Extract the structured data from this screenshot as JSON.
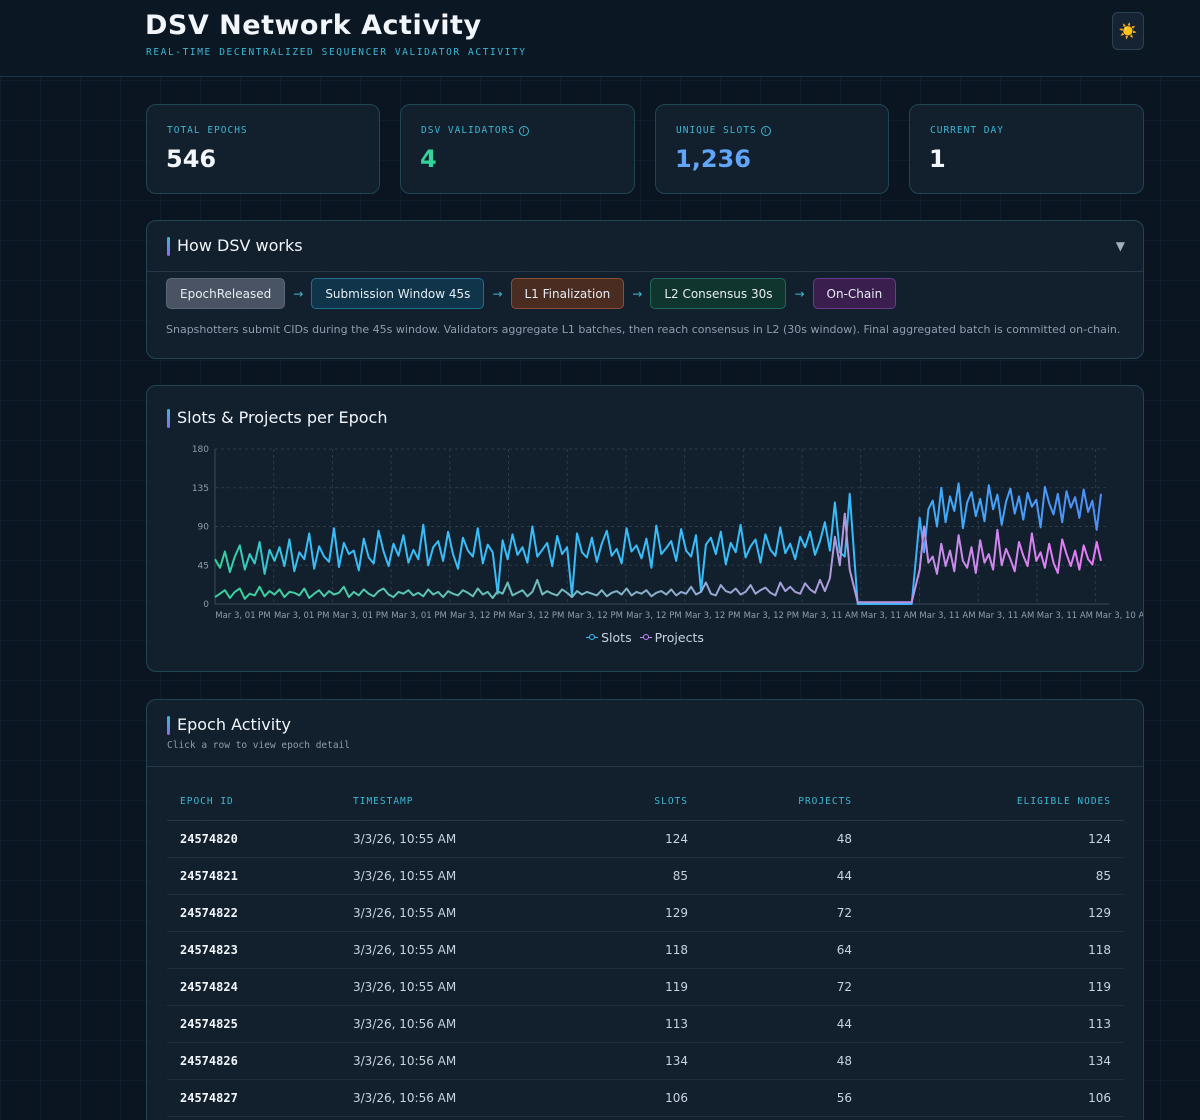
{
  "header": {
    "title": "DSV Network Activity",
    "subtitle": "REAL-TIME DECENTRALIZED SEQUENCER VALIDATOR ACTIVITY",
    "theme_icon": "sun-icon",
    "theme_glyph": "☀️"
  },
  "stats": [
    {
      "label": "TOTAL EPOCHS",
      "value": "546",
      "color": "#f2f6fa",
      "info": false
    },
    {
      "label": "DSV VALIDATORS",
      "value": "4",
      "color": "#34d399",
      "info": true
    },
    {
      "label": "UNIQUE SLOTS",
      "value": "1,236",
      "color": "#60a5fa",
      "info": true
    },
    {
      "label": "CURRENT DAY",
      "value": "1",
      "color": "#f2f6fa",
      "info": false
    }
  ],
  "how": {
    "title": "How DSV works",
    "chevron": "▼",
    "steps": [
      {
        "label": "EpochReleased",
        "bg": "#4a5363",
        "border": "#5c6676"
      },
      {
        "label": "Submission Window 45s",
        "bg": "#10344a",
        "border": "#1f6f93"
      },
      {
        "label": "L1 Finalization",
        "bg": "#4a2c20",
        "border": "#8a4f35"
      },
      {
        "label": "L2 Consensus 30s",
        "bg": "#10352f",
        "border": "#1f6a5a"
      },
      {
        "label": "On-Chain",
        "bg": "#3a1f4e",
        "border": "#6a3a8e"
      }
    ],
    "arrow": "→",
    "description": "Snapshotters submit CIDs during the 45s window. Validators aggregate L1 batches, then reach consensus in L2 (30s window). Final aggregated batch is committed on-chain."
  },
  "chart": {
    "title": "Slots & Projects per Epoch"
  },
  "chart_data": {
    "type": "line",
    "ylim": [
      0,
      180
    ],
    "yticks": [
      0,
      45,
      90,
      135,
      180
    ],
    "x_tick_labels": [
      "Mar 3, 01 PM",
      "Mar 3, 01 PM",
      "Mar 3, 01 PM",
      "Mar 3, 01 PM",
      "Mar 3, 12 PM",
      "Mar 3, 12 PM",
      "Mar 3, 12 PM",
      "Mar 3, 12 PM",
      "Mar 3, 12 PM",
      "Mar 3, 12 PM",
      "Mar 3, 11 AM",
      "Mar 3, 11 AM",
      "Mar 3, 11 AM",
      "Mar 3, 11 AM",
      "Mar 3, 11 AM",
      "Mar 3, 10 AM"
    ],
    "grid": true,
    "legend_position": "bottom",
    "series": [
      {
        "name": "Slots",
        "color": "#38bdf8",
        "values": [
          52,
          42,
          61,
          37,
          55,
          68,
          40,
          58,
          47,
          72,
          35,
          63,
          50,
          66,
          44,
          75,
          38,
          60,
          52,
          82,
          41,
          67,
          55,
          49,
          88,
          43,
          71,
          58,
          62,
          39,
          76,
          54,
          47,
          85,
          61,
          44,
          70,
          56,
          80,
          48,
          63,
          52,
          92,
          45,
          66,
          73,
          50,
          84,
          58,
          41,
          77,
          62,
          55,
          88,
          47,
          69,
          60,
          12,
          74,
          52,
          81,
          57,
          66,
          48,
          90,
          55,
          63,
          71,
          44,
          79,
          58,
          66,
          10,
          82,
          60,
          54,
          77,
          49,
          70,
          85,
          56,
          64,
          47,
          88,
          61,
          68,
          53,
          76,
          42,
          91,
          58,
          65,
          73,
          50,
          87,
          62,
          55,
          80,
          15,
          69,
          77,
          58,
          84,
          46,
          71,
          60,
          92,
          54,
          67,
          75,
          48,
          81,
          63,
          56,
          89,
          59,
          70,
          52,
          78,
          66,
          84,
          57,
          73,
          95,
          62,
          118,
          60,
          55,
          128
        ]
      },
      {
        "name": "Projects",
        "color": "#c084fc",
        "values": [
          8,
          12,
          16,
          7,
          14,
          18,
          6,
          12,
          10,
          20,
          9,
          15,
          11,
          17,
          8,
          14,
          13,
          10,
          18,
          7,
          12,
          16,
          9,
          15,
          11,
          13,
          20,
          8,
          14,
          10,
          17,
          12,
          9,
          15,
          18,
          11,
          8,
          14,
          12,
          16,
          10,
          13,
          9,
          17,
          11,
          14,
          8,
          15,
          12,
          10,
          16,
          13,
          9,
          18,
          11,
          14,
          7,
          15,
          12,
          25,
          10,
          13,
          16,
          9,
          14,
          28,
          11,
          15,
          12,
          10,
          17,
          13,
          8,
          15,
          11,
          14,
          12,
          10,
          16,
          9,
          13,
          15,
          11,
          18,
          10,
          14,
          12,
          16,
          9,
          13,
          15,
          11,
          17,
          10,
          14,
          12,
          20,
          11,
          14,
          25,
          12,
          10,
          22,
          15,
          13,
          18,
          11,
          14,
          22,
          12,
          16,
          19,
          13,
          10,
          25,
          15,
          20,
          14,
          12,
          24,
          17,
          13,
          28,
          15,
          30,
          78,
          45,
          105,
          40
        ]
      }
    ],
    "series_right": [
      {
        "name": "Slots",
        "values": [
          100,
          60,
          110,
          120,
          90,
          135,
          95,
          125,
          108,
          140,
          88,
          118,
          130,
          102,
          122,
          96,
          138,
          110,
          127,
          92,
          119,
          134,
          105,
          125,
          98,
          129,
          113,
          121,
          89,
          136,
          117,
          104,
          128,
          95,
          131,
          112,
          124,
          100,
          133,
          107,
          120,
          86,
          128
        ]
      },
      {
        "name": "Projects",
        "values": [
          40,
          90,
          48,
          55,
          35,
          70,
          44,
          62,
          38,
          80,
          50,
          42,
          66,
          36,
          74,
          48,
          58,
          40,
          86,
          45,
          64,
          52,
          38,
          72,
          56,
          44,
          82,
          50,
          60,
          42,
          70,
          48,
          36,
          75,
          58,
          44,
          62,
          40,
          68,
          52,
          46,
          72,
          50
        ]
      }
    ]
  },
  "table": {
    "title": "Epoch Activity",
    "subtitle": "Click a row to view epoch detail",
    "headers": [
      "EPOCH ID",
      "TIMESTAMP",
      "SLOTS",
      "PROJECTS",
      "ELIGIBLE NODES"
    ],
    "rows": [
      [
        "24574820",
        "3/3/26, 10:55 AM",
        "124",
        "48",
        "124"
      ],
      [
        "24574821",
        "3/3/26, 10:55 AM",
        "85",
        "44",
        "85"
      ],
      [
        "24574822",
        "3/3/26, 10:55 AM",
        "129",
        "72",
        "129"
      ],
      [
        "24574823",
        "3/3/26, 10:55 AM",
        "118",
        "64",
        "118"
      ],
      [
        "24574824",
        "3/3/26, 10:55 AM",
        "119",
        "72",
        "119"
      ],
      [
        "24574825",
        "3/3/26, 10:56 AM",
        "113",
        "44",
        "113"
      ],
      [
        "24574826",
        "3/3/26, 10:56 AM",
        "134",
        "48",
        "134"
      ],
      [
        "24574827",
        "3/3/26, 10:56 AM",
        "106",
        "56",
        "106"
      ]
    ]
  }
}
